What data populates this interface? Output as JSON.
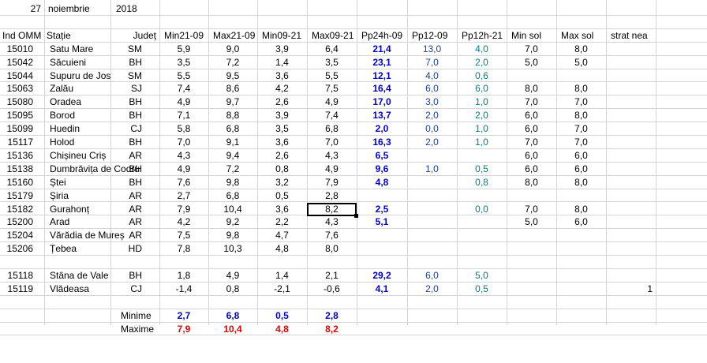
{
  "date": {
    "day": "27",
    "month": "noiembrie",
    "year": "2018"
  },
  "headers": [
    "Ind OMM",
    "Stație",
    "Județ",
    "Min21-09",
    "Max21-09",
    "Min09-21",
    "Max09-21",
    "Pp24h-09",
    "Pp12-09",
    "Pp12h-21",
    "Min sol",
    "Max sol",
    "strat nea"
  ],
  "rows": [
    [
      "15010",
      "Satu Mare",
      "SM",
      "5,9",
      "9,0",
      "3,9",
      "6,4",
      "21,4",
      "13,0",
      "4,0",
      "7,0",
      "8,0",
      ""
    ],
    [
      "15042",
      "Săcuieni",
      "BH",
      "3,5",
      "7,2",
      "1,4",
      "3,5",
      "23,1",
      "7,0",
      "2,0",
      "5,0",
      "5,0",
      ""
    ],
    [
      "15044",
      "Supuru de Jos",
      "SM",
      "5,5",
      "9,5",
      "3,6",
      "5,5",
      "12,1",
      "4,0",
      "0,6",
      "",
      "",
      ""
    ],
    [
      "15063",
      "Zalău",
      "SJ",
      "7,4",
      "8,6",
      "4,2",
      "7,5",
      "16,4",
      "6,0",
      "6,0",
      "8,0",
      "8,0",
      ""
    ],
    [
      "15080",
      "Oradea",
      "BH",
      "4,9",
      "9,7",
      "2,6",
      "4,9",
      "17,0",
      "3,0",
      "1,0",
      "7,0",
      "7,0",
      ""
    ],
    [
      "15095",
      "Borod",
      "BH",
      "7,1",
      "8,8",
      "3,9",
      "7,4",
      "13,7",
      "2,0",
      "2,0",
      "6,0",
      "8,0",
      ""
    ],
    [
      "15099",
      "Huedin",
      "CJ",
      "5,8",
      "6,8",
      "3,5",
      "6,8",
      "2,0",
      "0,0",
      "1,0",
      "6,0",
      "7,0",
      ""
    ],
    [
      "15117",
      "Holod",
      "BH",
      "7,0",
      "9,1",
      "3,6",
      "7,0",
      "16,3",
      "2,0",
      "1,0",
      "7,0",
      "7,0",
      ""
    ],
    [
      "15136",
      "Chișineu    Criș",
      "AR",
      "4,3",
      "9,4",
      "2,6",
      "4,3",
      "6,5",
      "",
      "",
      "6,0",
      "6,0",
      ""
    ],
    [
      "15138",
      "Dumbrăvița de Codru",
      "BH",
      "4,9",
      "7,2",
      "0,8",
      "4,9",
      "9,6",
      "1,0",
      "0,5",
      "6,0",
      "6,0",
      ""
    ],
    [
      "15160",
      "Ștei",
      "BH",
      "7,6",
      "9,8",
      "3,2",
      "7,9",
      "4,8",
      "",
      "0,8",
      "8,0",
      "8,0",
      ""
    ],
    [
      "15179",
      "Șiria",
      "AR",
      "2,7",
      "6,8",
      "0,5",
      "2,8",
      "",
      "",
      "",
      "",
      "",
      ""
    ],
    [
      "15182",
      "Gurahonț",
      "AR",
      "7,9",
      "10,4",
      "3,6",
      "8,2",
      "2,5",
      "",
      "0,0",
      "7,0",
      "8,0",
      ""
    ],
    [
      "15200",
      "Arad",
      "AR",
      "4,2",
      "9,2",
      "2,2",
      "4,3",
      "5,1",
      "",
      "",
      "5,0",
      "6,0",
      ""
    ],
    [
      "15204",
      "Vărădia de Mureș",
      "AR",
      "7,5",
      "9,8",
      "4,7",
      "7,6",
      "",
      "",
      "",
      "",
      "",
      ""
    ],
    [
      "15206",
      "Țebea",
      "HD",
      "7,8",
      "10,3",
      "4,8",
      "8,0",
      "",
      "",
      "",
      "",
      "",
      ""
    ],
    [
      "",
      "",
      "",
      "",
      "",
      "",
      "",
      "",
      "",
      "",
      "",
      "",
      ""
    ],
    [
      "15118",
      "Stâna de Vale",
      "BH",
      "1,8",
      "4,9",
      "1,4",
      "2,1",
      "29,2",
      "6,0",
      "5,0",
      "",
      "",
      ""
    ],
    [
      "15119",
      "Vlădeasa",
      "CJ",
      "-1,4",
      "0,8",
      "-2,1",
      "-0,6",
      "4,1",
      "2,0",
      "0,5",
      "",
      "",
      "1"
    ]
  ],
  "summary": {
    "min_label": "Minime",
    "max_label": "Maxime",
    "min_values": [
      "2,7",
      "6,8",
      "0,5",
      "2,8"
    ],
    "max_values": [
      "7,9",
      "10,4",
      "4,8",
      "8,2"
    ]
  },
  "colors": {
    "precip_24h": "#0000cc",
    "precip_12_09": "#1f3fa0",
    "precip_12_21": "#008080",
    "maxime": "#e00000",
    "gridline": "#d4d4d4"
  }
}
